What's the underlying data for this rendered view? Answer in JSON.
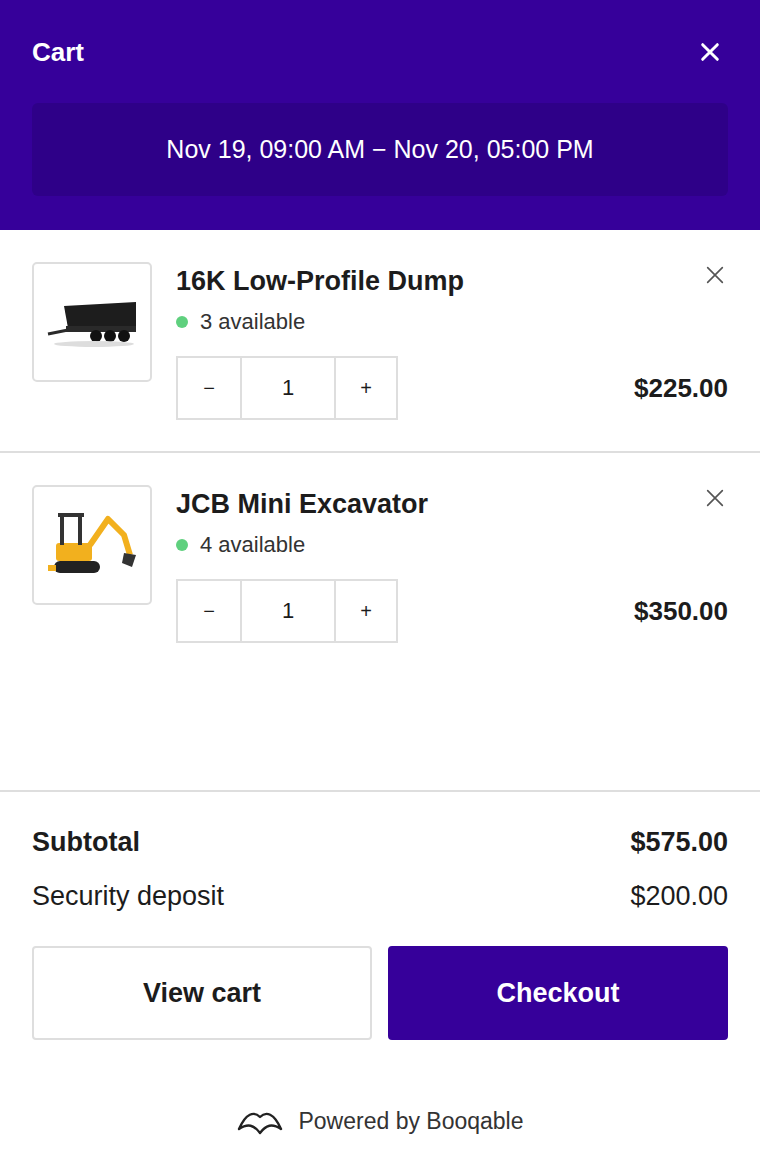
{
  "cart": {
    "title": "Cart",
    "date_range": "Nov 19, 09:00 AM − Nov 20, 05:00 PM"
  },
  "items": [
    {
      "name": "16K Low-Profile Dump",
      "availability": "3 available",
      "in_stock": true,
      "quantity": "1",
      "decrement": "−",
      "increment": "+",
      "price": "$225.00",
      "kind": "trailer"
    },
    {
      "name": "JCB Mini Excavator",
      "availability": "4 available",
      "in_stock": true,
      "quantity": "1",
      "decrement": "−",
      "increment": "+",
      "price": "$350.00",
      "kind": "excavator"
    }
  ],
  "summary": [
    {
      "label": "Subtotal",
      "value": "$575.00",
      "emphasis": true
    },
    {
      "label": "Security deposit",
      "value": "$200.00",
      "emphasis": false
    }
  ],
  "buttons": [
    {
      "label": "View cart",
      "primary": false
    },
    {
      "label": "Checkout",
      "primary": true
    }
  ],
  "footer": {
    "powered_by": "Powered by Booqable"
  }
}
